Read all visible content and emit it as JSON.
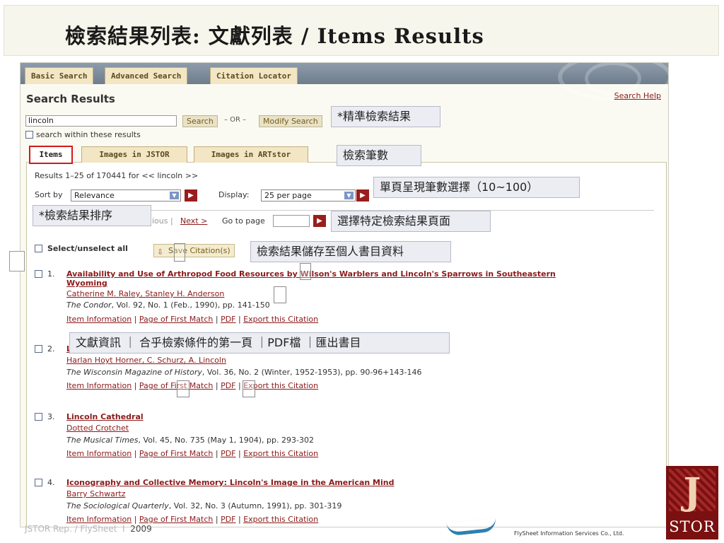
{
  "slide": {
    "title": "檢索結果列表: 文獻列表 / Items Results",
    "footer_left": "JSTOR  Rep. / FlySheet",
    "footer_sep": "I",
    "footer_year": "2009",
    "footer_company": "FlySheet Information Services Co., Ltd.",
    "logo_letter": "J",
    "logo_text": "STOR"
  },
  "tabs": [
    "Basic Search",
    "Advanced Search",
    "Citation Locator"
  ],
  "header": {
    "title": "Search Results",
    "help": "Search Help"
  },
  "search": {
    "value": "lincoln",
    "search_btn": "Search",
    "or": "– OR –",
    "modify_btn": "Modify Search",
    "within_label": "search within these results"
  },
  "result_tabs": [
    "Items",
    "Images in JSTOR",
    "Images in ARTstor"
  ],
  "summary": "Results 1–25 of 170441 for << lincoln >>",
  "sort": {
    "label": "Sort by",
    "value": "Relevance"
  },
  "display": {
    "label": "Display:",
    "value": "25 per page"
  },
  "pager": {
    "prev": "ious |",
    "next": "Next >",
    "goto": "Go to page"
  },
  "select_all": "Select/unselect all",
  "save_btn": "Save Citation(s)",
  "actions": {
    "info": "Item Information",
    "first": "Page of First Match",
    "pdf": "PDF",
    "export": "Export this Citation"
  },
  "results": [
    {
      "num": "1.",
      "title": "Availability and Use of Arthropod Food Resources by Wilson's Warblers and Lincoln's Sparrows in Southeastern Wyoming",
      "authors": "Catherine M. Raley, Stanley H. Anderson",
      "journal": "The Condor",
      "details": ", Vol. 92, No. 1 (Feb., 1990), pp. 141-150"
    },
    {
      "num": "2.",
      "title": "L",
      "authors": "Harlan Hoyt Horner, C. Schurz, A. Lincoln",
      "journal": "The Wisconsin Magazine of History",
      "details": ", Vol. 36, No. 2 (Winter, 1952-1953), pp. 90-96+143-146"
    },
    {
      "num": "3.",
      "title": "Lincoln Cathedral",
      "authors": "Dotted Crotchet",
      "journal": "The Musical Times",
      "details": ", Vol. 45, No. 735 (May 1, 1904), pp. 293-302"
    },
    {
      "num": "4.",
      "title": "Iconography and Collective Memory: Lincoln's Image in the American Mind",
      "authors": "Barry Schwartz",
      "journal": "The Sociological Quarterly",
      "details": ", Vol. 32, No. 3 (Autumn, 1991), pp. 301-319"
    }
  ],
  "callouts": {
    "refine": "*精準檢索結果",
    "count": "檢索筆數",
    "per_page": "單頁呈現筆數選擇（10~100）",
    "sort": "*檢索結果排序",
    "page": "選擇特定檢索結果頁面",
    "save": "檢索結果儲存至個人書目資料",
    "info": "文獻資訊 ｜ 合乎檢索條件的第一頁 ｜PDF檔 ｜匯出書目"
  },
  "colors": {
    "accent": "#8b1a1a",
    "tab_bg": "#f2e6c4",
    "highlight": "#d11a1a"
  }
}
